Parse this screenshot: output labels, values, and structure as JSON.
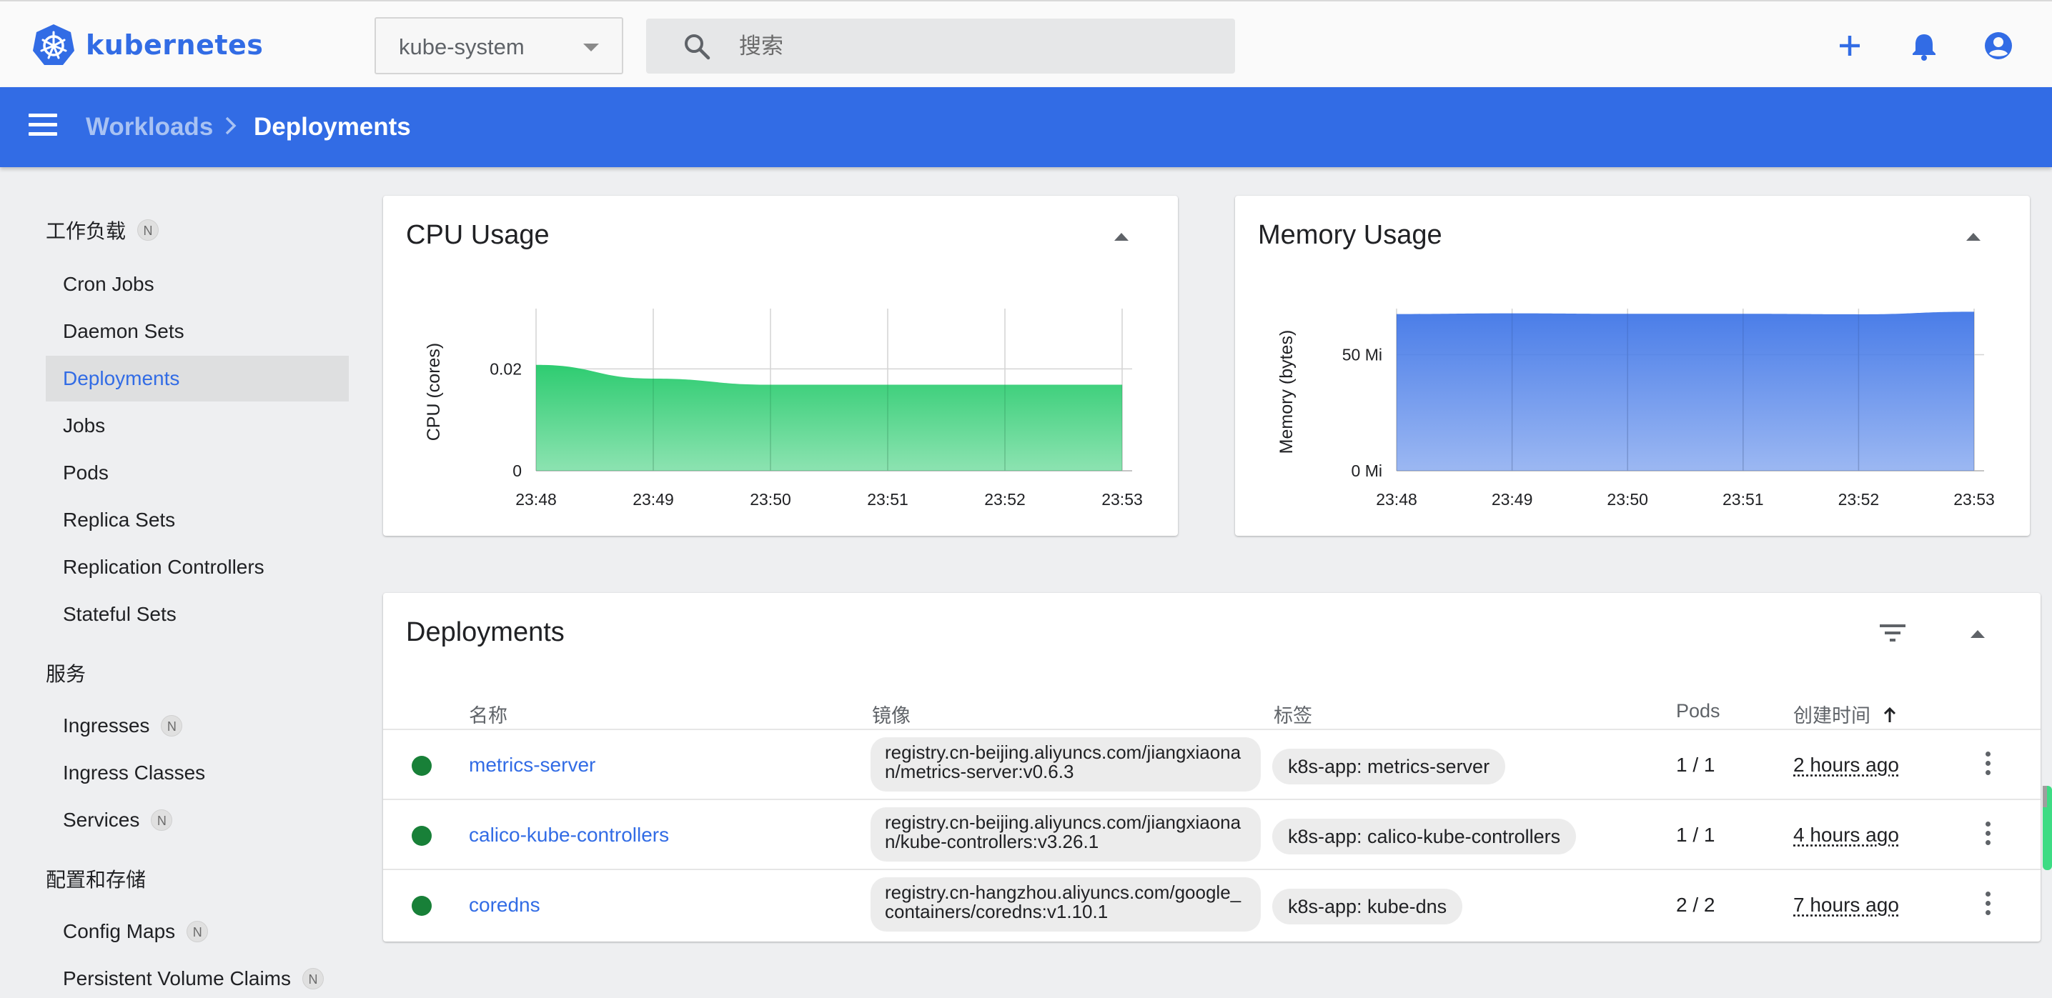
{
  "app": {
    "logo_text": "kubernetes"
  },
  "namespace": {
    "value": "kube-system"
  },
  "search": {
    "placeholder": "搜索"
  },
  "breadcrumb": {
    "parent": "Workloads",
    "current": "Deployments"
  },
  "sidebar": {
    "sections": [
      {
        "title": "工作负载",
        "badge": "N"
      },
      {
        "title": "服务"
      },
      {
        "title": "配置和存储"
      }
    ],
    "workloads": [
      "Cron Jobs",
      "Daemon Sets",
      "Deployments",
      "Jobs",
      "Pods",
      "Replica Sets",
      "Replication Controllers",
      "Stateful Sets"
    ],
    "services": [
      {
        "label": "Ingresses",
        "badge": "N"
      },
      {
        "label": "Ingress Classes"
      },
      {
        "label": "Services",
        "badge": "N"
      }
    ],
    "config": [
      {
        "label": "Config Maps",
        "badge": "N"
      },
      {
        "label": "Persistent Volume Claims",
        "badge": "N"
      }
    ],
    "active": "Deployments"
  },
  "colors": {
    "brand": "#326ce5",
    "cpu": "#2ecc71",
    "memory": "#4a7de8",
    "running": "#188038"
  },
  "chart_data": [
    {
      "type": "area",
      "title": "CPU Usage",
      "ylabel": "CPU (cores)",
      "x": [
        "23:48",
        "23:49",
        "23:50",
        "23:51",
        "23:52",
        "23:53"
      ],
      "yticks": [
        "0",
        "0.02"
      ],
      "ylim": [
        0,
        0.031
      ],
      "series": [
        {
          "values": [
            0.0208,
            0.0181,
            0.0169,
            0.0169,
            0.0169,
            0.0169
          ]
        }
      ],
      "grid": true
    },
    {
      "type": "area",
      "title": "Memory Usage",
      "ylabel": "Memory (bytes)",
      "x": [
        "23:48",
        "23:49",
        "23:50",
        "23:51",
        "23:52",
        "23:53"
      ],
      "yticks": [
        "0 Mi",
        "50 Mi"
      ],
      "ylim": [
        0,
        68
      ],
      "series": [
        {
          "values": [
            67.5,
            67.8,
            67.6,
            67.6,
            67.4,
            68.5
          ]
        }
      ],
      "grid": true
    }
  ],
  "deployments": {
    "title": "Deployments",
    "columns": {
      "name": "名称",
      "image": "镜像",
      "labels": "标签",
      "pods": "Pods",
      "created": "创建时间"
    },
    "rows": [
      {
        "name": "metrics-server",
        "image": "registry.cn-beijing.aliyuncs.com/jiangxiaonan/metrics-server:v0.6.3",
        "label": "k8s-app: metrics-server",
        "pods": "1 / 1",
        "created": "2 hours ago"
      },
      {
        "name": "calico-kube-controllers",
        "image": "registry.cn-beijing.aliyuncs.com/jiangxiaonan/kube-controllers:v3.26.1",
        "label": "k8s-app: calico-kube-controllers",
        "pods": "1 / 1",
        "created": "4 hours ago"
      },
      {
        "name": "coredns",
        "image": "registry.cn-hangzhou.aliyuncs.com/google_containers/coredns:v1.10.1",
        "label": "k8s-app: kube-dns",
        "pods": "2 / 2",
        "created": "7 hours ago"
      }
    ]
  }
}
